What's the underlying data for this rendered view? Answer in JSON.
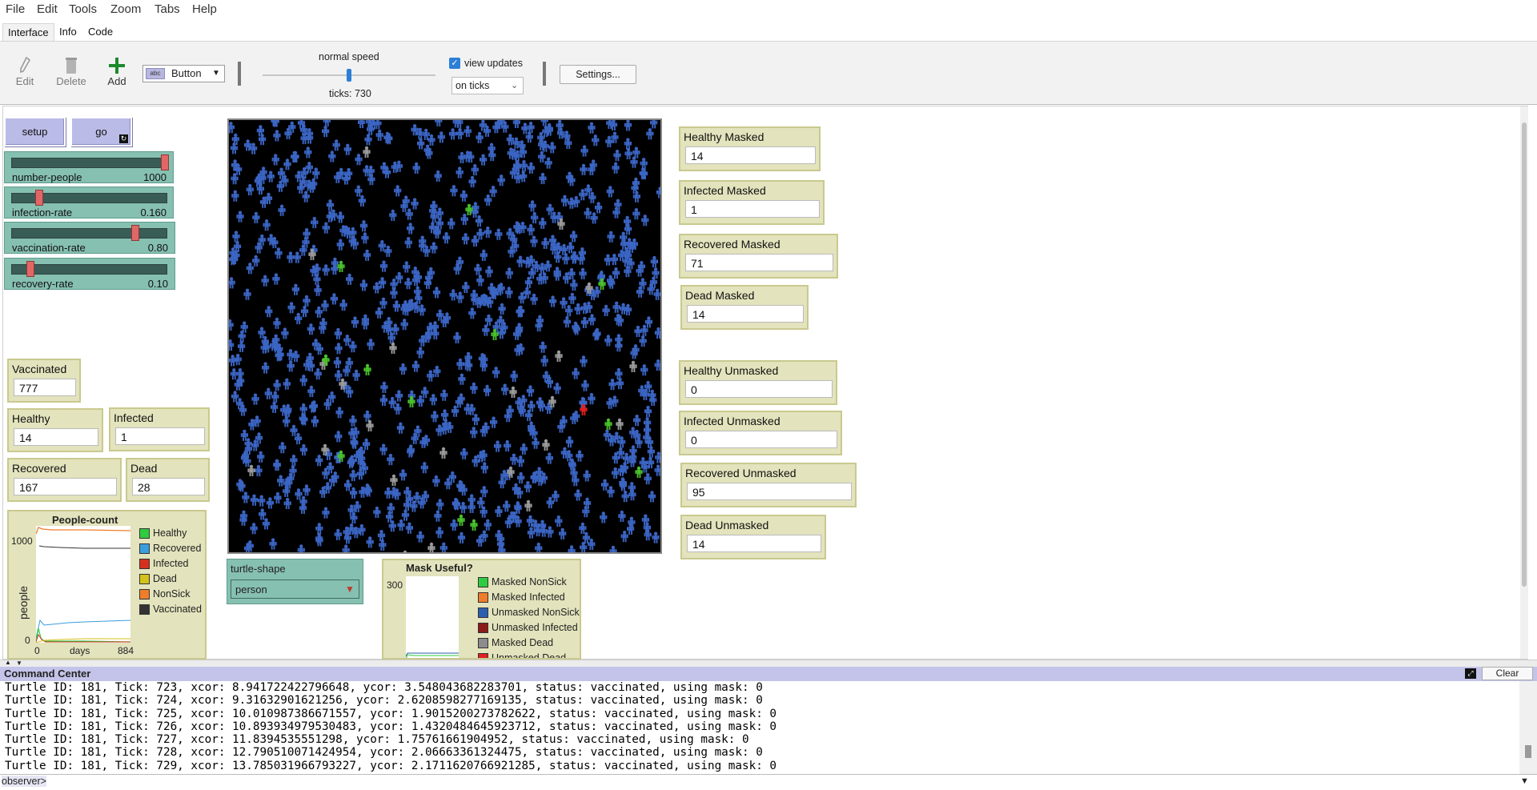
{
  "menubar": {
    "items": [
      "File",
      "Edit",
      "Tools",
      "Zoom",
      "Tabs",
      "Help"
    ]
  },
  "tabs": [
    "Interface",
    "Info",
    "Code"
  ],
  "toolbar": {
    "edit_label": "Edit",
    "delete_label": "Delete",
    "add_label": "Add",
    "widget_type": "Button",
    "speed_label": "normal speed",
    "speed_level": 0.5,
    "ticks_label": "ticks: 730",
    "view_updates_label": "view updates",
    "view_updates_checked": true,
    "update_mode": "on ticks",
    "settings_label": "Settings..."
  },
  "buttons": {
    "setup": "setup",
    "go": "go"
  },
  "sliders": [
    {
      "label": "number-people",
      "value": "1000",
      "level": 1.0
    },
    {
      "label": "infection-rate",
      "value": "0.160",
      "level": 0.16
    },
    {
      "label": "vaccination-rate",
      "value": "0.80",
      "level": 0.8
    },
    {
      "label": "recovery-rate",
      "value": "0.10",
      "level": 0.1
    }
  ],
  "monitors_left": {
    "vaccinated": {
      "label": "Vaccinated",
      "value": "777"
    },
    "healthy": {
      "label": "Healthy",
      "value": "14"
    },
    "infected": {
      "label": "Infected",
      "value": "1"
    },
    "recovered": {
      "label": "Recovered",
      "value": "167"
    },
    "dead": {
      "label": "Dead",
      "value": "28"
    }
  },
  "monitors_right": [
    {
      "label": "Healthy Masked",
      "value": "14"
    },
    {
      "label": "Infected Masked",
      "value": "1"
    },
    {
      "label": "Recovered Masked",
      "value": "71"
    },
    {
      "label": "Dead Masked",
      "value": "14"
    },
    {
      "label": "Healthy Unmasked",
      "value": "0"
    },
    {
      "label": "Infected Unmasked",
      "value": "0"
    },
    {
      "label": "Recovered Unmasked",
      "value": "95"
    },
    {
      "label": "Dead Unmasked",
      "value": "14"
    }
  ],
  "chooser": {
    "label": "turtle-shape",
    "value": "person"
  },
  "people_plot": {
    "title": "People-count",
    "ylabel": "people",
    "xlabel": "days",
    "ymax_label": "1000",
    "ymin_label": "0",
    "xmin_label": "0",
    "xmax_label": "884",
    "legend": [
      {
        "name": "Healthy",
        "color": "#2ecc40"
      },
      {
        "name": "Recovered",
        "color": "#3b9ddd"
      },
      {
        "name": "Infected",
        "color": "#d7301f"
      },
      {
        "name": "Dead",
        "color": "#d4c21a"
      },
      {
        "name": "NonSick",
        "color": "#f07d2a"
      },
      {
        "name": "Vaccinated",
        "color": "#333333"
      }
    ]
  },
  "mask_plot": {
    "title": "Mask Useful?",
    "ymax_label": "300",
    "legend": [
      {
        "name": "Masked NonSick",
        "color": "#2ecc40"
      },
      {
        "name": "Masked Infected",
        "color": "#f07d2a"
      },
      {
        "name": "Unmasked NonSick",
        "color": "#2b5fb0"
      },
      {
        "name": "Unmasked Infected",
        "color": "#8b1a1a"
      },
      {
        "name": "Masked Dead",
        "color": "#8c8c8c"
      },
      {
        "name": "Unmasked Dead",
        "color": "#e02020"
      }
    ]
  },
  "command_center": {
    "title": "Command Center",
    "clear_label": "Clear",
    "prompt": "observer>",
    "lines": [
      "Turtle ID: 181, Tick: 723, xcor: 8.941722422796648, ycor: 3.548043682283701, status: vaccinated, using mask: 0",
      "Turtle ID: 181, Tick: 724, xcor: 9.31632901621256, ycor: 2.6208598277169135, status: vaccinated, using mask: 0",
      "Turtle ID: 181, Tick: 725, xcor: 10.010987386671557, ycor: 1.9015200273782622, status: vaccinated, using mask: 0",
      "Turtle ID: 181, Tick: 726, xcor: 10.893934979530483, ycor: 1.4320484645923712, status: vaccinated, using mask: 0",
      "Turtle ID: 181, Tick: 727, xcor: 11.8394535551298, ycor: 1.75761661904952, status: vaccinated, using mask: 0",
      "Turtle ID: 181, Tick: 728, xcor: 12.790510071424954, ycor: 2.06663361324475, status: vaccinated, using mask: 0",
      "Turtle ID: 181, Tick: 729, xcor: 13.785031966793227, ycor: 2.1711620766921285, status: vaccinated, using mask: 0"
    ]
  }
}
